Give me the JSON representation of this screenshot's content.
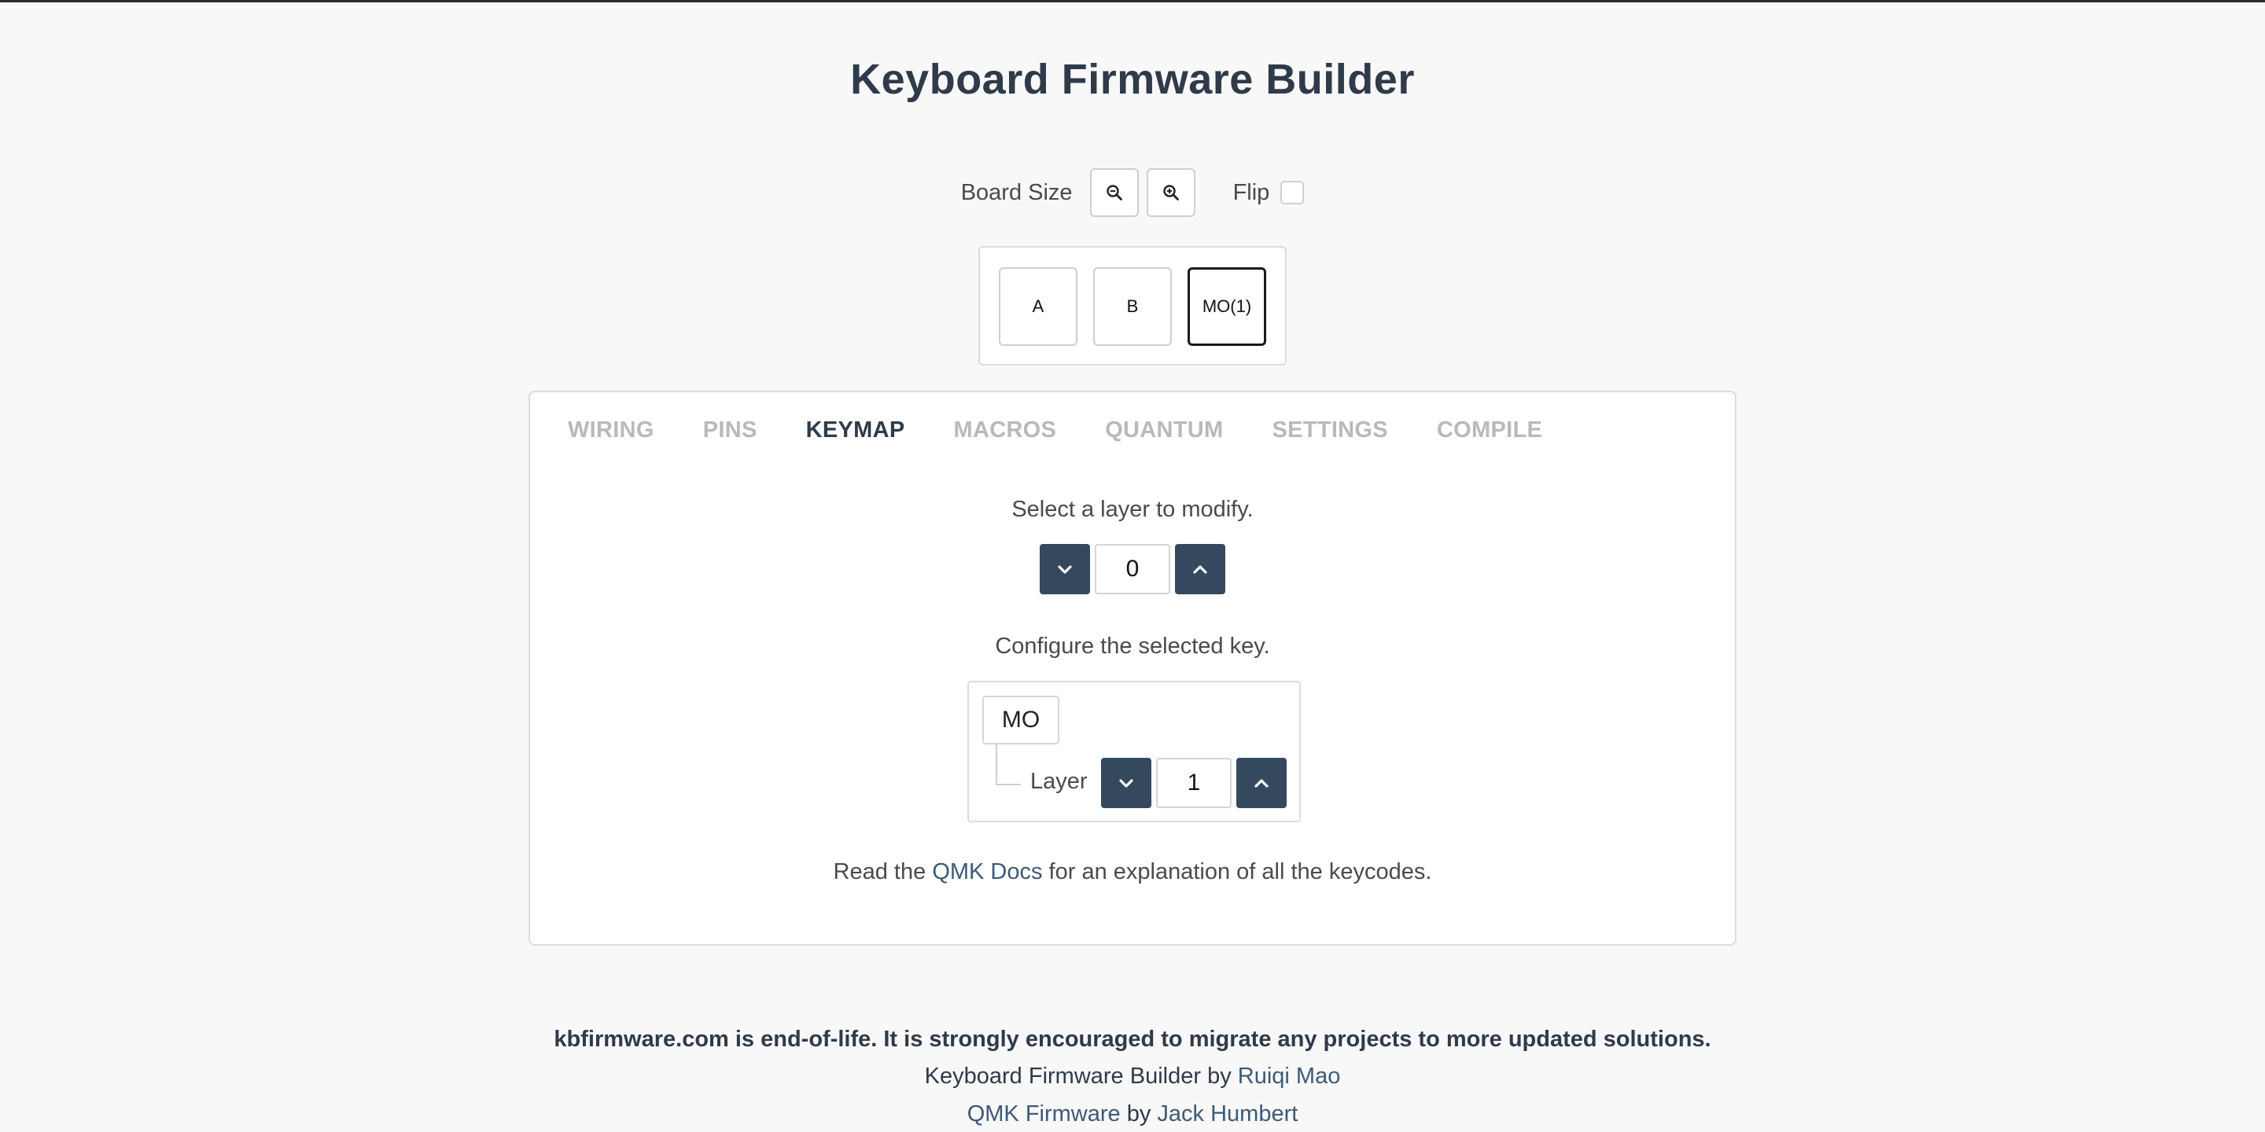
{
  "app": {
    "title": "Keyboard Firmware Builder"
  },
  "board_controls": {
    "size_label": "Board Size",
    "zoom_out_icon": "zoom-out-icon",
    "zoom_in_icon": "zoom-in-icon",
    "flip_label": "Flip",
    "flip_checked": false
  },
  "board": {
    "keys": [
      {
        "label": "A",
        "selected": false
      },
      {
        "label": "B",
        "selected": false
      },
      {
        "label": "MO(1)",
        "selected": true
      }
    ]
  },
  "tabs": [
    {
      "label": "WIRING",
      "active": false
    },
    {
      "label": "PINS",
      "active": false
    },
    {
      "label": "KEYMAP",
      "active": true
    },
    {
      "label": "MACROS",
      "active": false
    },
    {
      "label": "QUANTUM",
      "active": false
    },
    {
      "label": "SETTINGS",
      "active": false
    },
    {
      "label": "COMPILE",
      "active": false
    }
  ],
  "keymap": {
    "layer_prompt": "Select a layer to modify.",
    "layer_value": "0",
    "key_prompt": "Configure the selected key.",
    "key_code": "MO",
    "param_label": "Layer",
    "param_value": "1",
    "docs_prefix": "Read the ",
    "docs_link": "QMK Docs",
    "docs_suffix": " for an explanation of all the keycodes."
  },
  "footer": {
    "notice": "kbfirmware.com is end-of-life. It is strongly encouraged to migrate any projects to more updated solutions.",
    "credit1_prefix": "Keyboard Firmware Builder by ",
    "credit1_link": "Ruiqi Mao",
    "credit2_link1": "QMK Firmware",
    "credit2_mid": " by ",
    "credit2_link2": "Jack Humbert"
  },
  "colors": {
    "accent": "#34495e",
    "link": "#3d5a78",
    "tab_inactive": "#b9b9b9",
    "text": "#2f3a4a"
  }
}
